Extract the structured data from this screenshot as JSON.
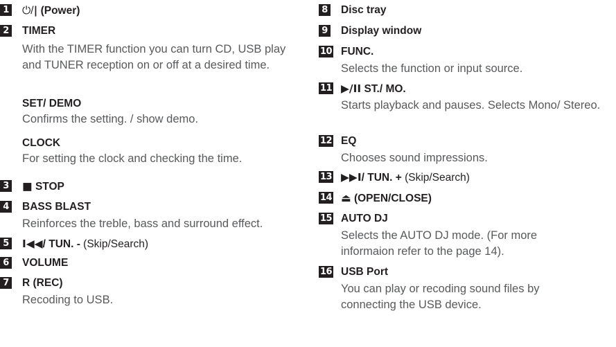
{
  "items": {
    "i1": {
      "num": "1",
      "glyph": "⏻",
      "sep": "/",
      "bar": "|",
      "label": "(Power)"
    },
    "i2": {
      "num": "2",
      "label": "TIMER",
      "desc": "With the TIMER function you can turn CD, USB play and TUNER reception on or off at a desired time."
    },
    "i2_set": {
      "label": "SET/ DEMO",
      "desc": "Confirms the setting. / show demo."
    },
    "i2_clock": {
      "label": "CLOCK",
      "desc": "For setting the clock and checking the time."
    },
    "i3": {
      "num": "3",
      "glyph": "■",
      "label": "STOP"
    },
    "i4": {
      "num": "4",
      "label": "BASS BLAST",
      "desc": "Reinforces the treble, bass and surround effect."
    },
    "i5": {
      "num": "5",
      "glyph": "I◀◀",
      "label": "/ TUN. -",
      "suffix": "(Skip/Search)"
    },
    "i6": {
      "num": "6",
      "label": "VOLUME"
    },
    "i7": {
      "num": "7",
      "label": "R (REC)",
      "desc": "Recoding to USB."
    },
    "i8": {
      "num": "8",
      "label": "Disc tray"
    },
    "i9": {
      "num": "9",
      "label": "Display window"
    },
    "i10": {
      "num": "10",
      "label": "FUNC.",
      "desc": "Selects the function or input source."
    },
    "i11": {
      "num": "11",
      "glyph": "▶/II",
      "label": "ST./ MO.",
      "desc": "Starts playback and pauses. Selects Mono/ Stereo."
    },
    "i12": {
      "num": "12",
      "label": "EQ",
      "desc": "Chooses sound impressions."
    },
    "i13": {
      "num": "13",
      "glyph": "▶▶I",
      "label": "/ TUN. +",
      "suffix": "(Skip/Search)"
    },
    "i14": {
      "num": "14",
      "glyph": "⏏",
      "label": "(OPEN/CLOSE)"
    },
    "i15": {
      "num": "15",
      "label": "AUTO DJ",
      "desc": "Selects the AUTO DJ mode. (For more informaion refer to the page 14)."
    },
    "i16": {
      "num": "16",
      "label": "USB Port",
      "desc": "You can play or recoding sound files by connecting the USB device."
    }
  }
}
